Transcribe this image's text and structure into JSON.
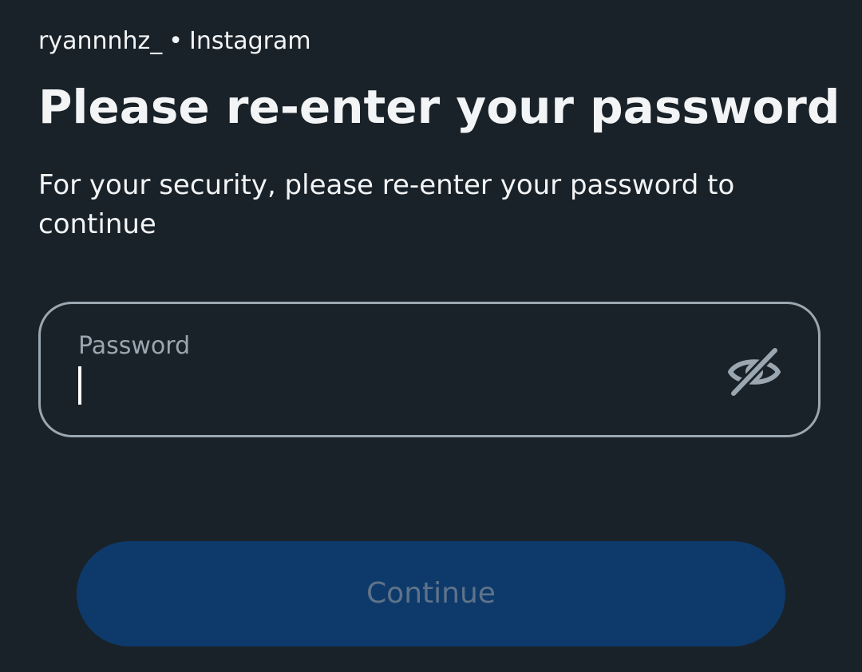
{
  "header": {
    "username": "ryannnhz_",
    "separator": "•",
    "app_name": "Instagram"
  },
  "title": "Please re-enter your password",
  "subtitle": "For your security, please re-enter your password to continue",
  "password_field": {
    "label": "Password",
    "value": "",
    "toggle_icon": "eye-slash-icon"
  },
  "continue_button": {
    "label": "Continue",
    "enabled": false
  },
  "colors": {
    "background": "#1a2229",
    "text_primary": "#f2f4f5",
    "field_border": "#9aa7b0",
    "button_bg_disabled": "#0e3a6b",
    "button_text_disabled": "#5f7389"
  }
}
